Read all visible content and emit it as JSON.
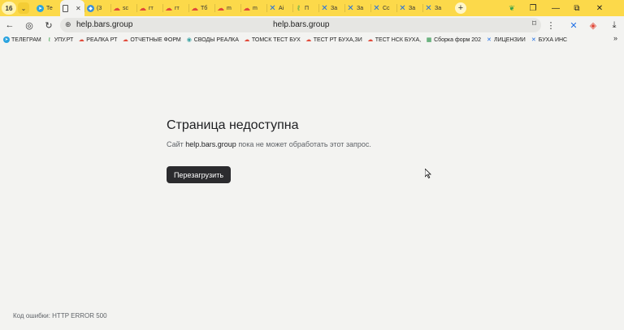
{
  "browser": {
    "tab_count": "16",
    "tabs": [
      {
        "label": "Те",
        "icon": "telegram-icon",
        "color": "#2aa3df"
      },
      {
        "label": "",
        "icon": "document-icon",
        "color": "#555555",
        "active": true
      },
      {
        "label": "(3",
        "icon": "app-icon",
        "color": "#3b8fd9"
      },
      {
        "label": "sc",
        "icon": "cloud-icon",
        "color": "#e14a3a"
      },
      {
        "label": "гт",
        "icon": "cloud-icon",
        "color": "#e14a3a"
      },
      {
        "label": "гт",
        "icon": "cloud-icon",
        "color": "#e14a3a"
      },
      {
        "label": "Тб",
        "icon": "cloud-icon",
        "color": "#e14a3a"
      },
      {
        "label": "m",
        "icon": "cloud-icon",
        "color": "#e14a3a"
      },
      {
        "label": "m",
        "icon": "cloud-icon",
        "color": "#e14a3a"
      },
      {
        "label": "Ai",
        "icon": "confluence-icon",
        "color": "#1f6fe5"
      },
      {
        "label": "П",
        "icon": "leaf-icon",
        "color": "#3aa34a"
      },
      {
        "label": "За",
        "icon": "confluence-icon",
        "color": "#1f6fe5"
      },
      {
        "label": "За",
        "icon": "confluence-icon",
        "color": "#1f6fe5"
      },
      {
        "label": "Сс",
        "icon": "confluence-icon",
        "color": "#1f6fe5"
      },
      {
        "label": "За",
        "icon": "confluence-icon",
        "color": "#1f6fe5"
      },
      {
        "label": "За",
        "icon": "confluence-icon",
        "color": "#1f6fe5"
      }
    ],
    "url": "help.bars.group",
    "url_center": "help.bars.group",
    "bookmarks": [
      {
        "label": "ТЕЛЕГРАМ",
        "icon": "telegram-icon",
        "color": "#2aa3df"
      },
      {
        "label": "УПУ.РТ",
        "icon": "leaf-icon",
        "color": "#3aa34a"
      },
      {
        "label": "РЕАЛКА РТ",
        "icon": "cloud-icon",
        "color": "#e14a3a"
      },
      {
        "label": "ОТЧЕТНЫЕ ФОРМ",
        "icon": "cloud-icon",
        "color": "#e14a3a"
      },
      {
        "label": "СВОДЫ РЕАЛКА",
        "icon": "globe-icon",
        "color": "#3aa3a3"
      },
      {
        "label": "ТОМСК ТЕСТ БУХ",
        "icon": "cloud-icon",
        "color": "#e14a3a"
      },
      {
        "label": "ТЕСТ РТ БУХА,ЗИ",
        "icon": "cloud-icon",
        "color": "#e14a3a"
      },
      {
        "label": "ТЕСТ НСК БУХА,",
        "icon": "cloud-icon",
        "color": "#e14a3a"
      },
      {
        "label": "Сборка форм 202",
        "icon": "sheets-icon",
        "color": "#1e8e3e"
      },
      {
        "label": "ЛИЦЕНЗИИ",
        "icon": "confluence-icon",
        "color": "#1f6fe5"
      },
      {
        "label": "БУХА ИНС",
        "icon": "confluence-icon",
        "color": "#1f6fe5"
      }
    ]
  },
  "error_page": {
    "title": "Страница недоступна",
    "desc_prefix": "Сайт ",
    "desc_host": "help.bars.group",
    "desc_suffix": " пока не может обработать этот запрос.",
    "reload_label": "Перезагрузить",
    "error_code": "Код ошибки: HTTP ERROR 500"
  },
  "colors": {
    "tabstrip": "#fcd94a",
    "background": "#f3f3f1",
    "button": "#2b2b2e"
  }
}
